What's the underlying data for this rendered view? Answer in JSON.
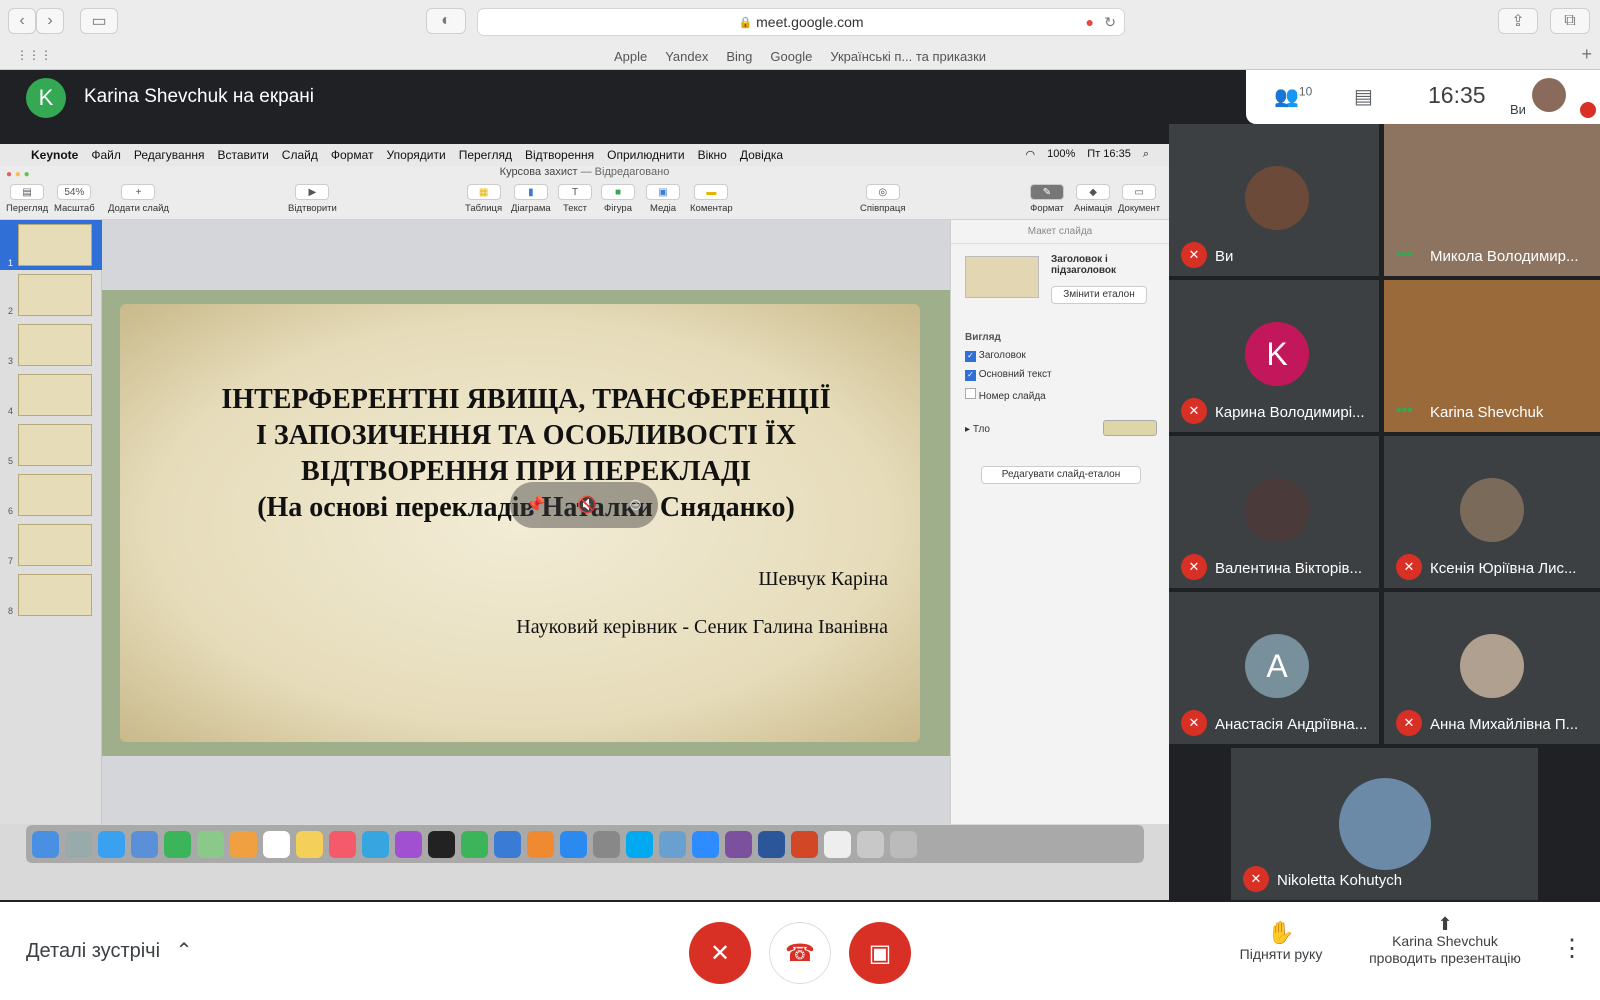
{
  "browser": {
    "url": "meet.google.com",
    "favorites": [
      "Apple",
      "Yandex",
      "Bing",
      "Google",
      "Українські п... та приказки"
    ]
  },
  "meet": {
    "presenter_initial": "K",
    "presenter_label": "Karina Shevchuk на екрані",
    "participant_count": "10",
    "time": "16:35",
    "you_label": "Ви",
    "details_label": "Деталі зустрічі",
    "raise_hand": "Підняти руку",
    "presenting_line1": "Karina Shevchuk",
    "presenting_line2": "проводить презентацію",
    "participants": [
      {
        "name": "Ви"
      },
      {
        "name": "Микола Володимир..."
      },
      {
        "name": "Карина Володимирі...",
        "initial": "K"
      },
      {
        "name": "Karina Shevchuk"
      },
      {
        "name": "Валентина Вікторів..."
      },
      {
        "name": "Ксенія Юріївна Лис..."
      },
      {
        "name": "Анастасія Андріївна...",
        "initial": "A"
      },
      {
        "name": "Анна Михайлівна П..."
      },
      {
        "name": "Nikoletta Kohutych"
      }
    ]
  },
  "mac": {
    "app": "Keynote",
    "menus": [
      "Файл",
      "Редагування",
      "Вставити",
      "Слайд",
      "Формат",
      "Упорядити",
      "Перегляд",
      "Відтворення",
      "Оприлюднити",
      "Вікно",
      "Довідка"
    ],
    "battery": "100%",
    "clock": "Пт 16:35"
  },
  "keynote": {
    "doc_title": "Курсова захист",
    "doc_status": "— Відредаговано",
    "zoom": "54%",
    "toolbar": [
      "Перегляд",
      "Масштаб",
      "Додати слайд",
      "Відтворити",
      "Таблиця",
      "Діаграма",
      "Текст",
      "Фігура",
      "Медіа",
      "Коментар",
      "Співпраця",
      "Формат",
      "Анімація",
      "Документ"
    ],
    "slide": {
      "title_lines": [
        "ІНТЕРФЕРЕНТНІ ЯВИЩА, ТРАНСФЕРЕНЦІЇ",
        "І ЗАПОЗИЧЕННЯ ТА ОСОБЛИВОСТІ ЇХ",
        "ВІДТВОРЕННЯ ПРИ ПЕРЕКЛАДІ",
        "(На основі перекладів Наталки Сняданко)"
      ],
      "author": "Шевчук Каріна",
      "supervisor": "Науковий керівник - Сеник Галина Іванівна"
    },
    "inspector": {
      "header": "Макет слайда",
      "layout_name": "Заголовок і підзаголовок",
      "change_master": "Змінити еталон",
      "view": "Вигляд",
      "opt_title": "Заголовок",
      "opt_body": "Основний текст",
      "opt_number": "Номер слайда",
      "background": "Тло",
      "edit_master": "Редагувати слайд-еталон"
    },
    "slide_numbers": [
      "1",
      "2",
      "3",
      "4",
      "5",
      "6",
      "7",
      "8"
    ]
  }
}
